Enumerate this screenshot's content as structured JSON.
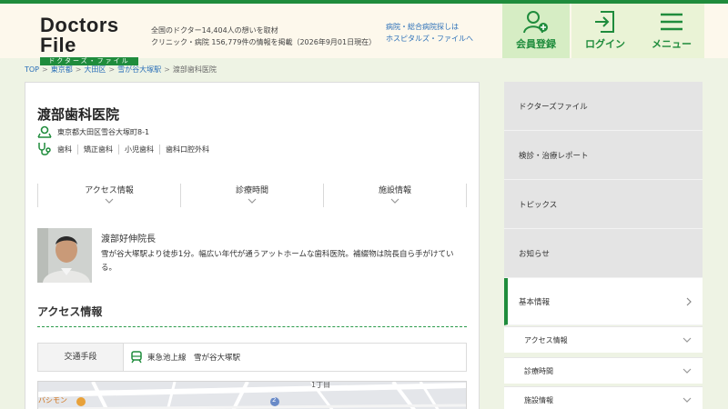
{
  "header": {
    "logo_main": "Doctors File",
    "logo_sub": "ドクターズ・ファイル",
    "tagline_1": "全国のドクター14,404人の想いを取材",
    "tagline_2": "クリニック・病院 156,779件の情報を掲載（2026年9月01日現在）",
    "hospital_link_1": "病院・総合病院探しは",
    "hospital_link_2": "ホスピタルズ・ファイルへ",
    "register_label": "会員登録",
    "login_label": "ログイン",
    "menu_label": "メニュー"
  },
  "breadcrumb": [
    "TOP",
    "東京都",
    "大田区",
    "雪が谷大塚駅",
    "渡部歯科医院"
  ],
  "clinic": {
    "name": "渡部歯科医院",
    "address": "東京都大田区雪谷大塚町8-1",
    "specialties": [
      "歯科",
      "矯正歯科",
      "小児歯科",
      "歯科口腔外科"
    ]
  },
  "tabs": [
    "アクセス情報",
    "診療時間",
    "施設情報"
  ],
  "doctor": {
    "name": "渡部好伸院長",
    "description": "雪が谷大塚駅より徒歩1分。幅広い年代が通うアットホームな歯科医院。補綴物は院長自ら手がけている。"
  },
  "access": {
    "title": "アクセス情報",
    "transport_label": "交通手段",
    "transport_value": "東急池上線　雪が谷大塚駅"
  },
  "map": {
    "label_1": "1丁目",
    "label_2": "バシモン",
    "label_3": "2"
  },
  "sidebar": {
    "items": [
      "ドクターズファイル",
      "検診・治療レポート",
      "トピックス",
      "お知らせ",
      "基本情報"
    ],
    "sub_items": [
      "アクセス情報",
      "診療時間",
      "施設情報"
    ]
  },
  "colors": {
    "brand_green": "#1f8c3c",
    "link_blue": "#2a6fb8",
    "header_bg": "#fdf8ec"
  }
}
